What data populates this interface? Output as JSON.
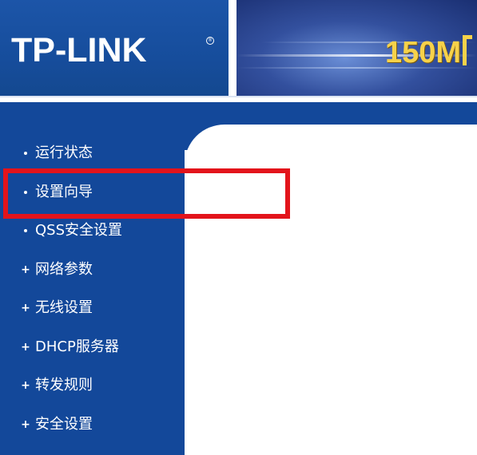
{
  "header": {
    "logo_text": "TP-LINK",
    "logo_mark": "®",
    "banner_text": "150M"
  },
  "sidebar": {
    "items": [
      {
        "label": "运行状态",
        "bullet": "dot"
      },
      {
        "label": "设置向导",
        "bullet": "dot"
      },
      {
        "label": "QSS安全设置",
        "bullet": "dot"
      },
      {
        "label": "网络参数",
        "bullet": "plus"
      },
      {
        "label": "无线设置",
        "bullet": "plus"
      },
      {
        "label": "DHCP服务器",
        "bullet": "plus"
      },
      {
        "label": "转发规则",
        "bullet": "plus"
      },
      {
        "label": "安全设置",
        "bullet": "plus"
      }
    ]
  },
  "bullets": {
    "plus": "+"
  },
  "colors": {
    "brand_blue": "#13489a",
    "banner_text": "#f6d24a",
    "highlight": "#e3141b"
  }
}
